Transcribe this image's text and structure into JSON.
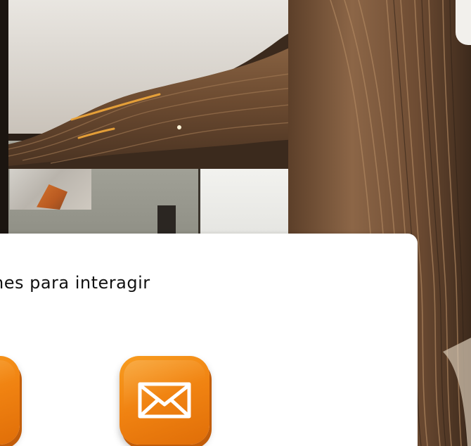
{
  "dialog": {
    "message": "nes para interagir",
    "buttons": [
      {
        "name": "contact-button",
        "icon": "phone-icon"
      },
      {
        "name": "email-button",
        "icon": "envelope-icon"
      }
    ]
  },
  "colors": {
    "accent": "#F08211",
    "accent_dark": "#C25D0A",
    "card_background": "#FFFFFF",
    "text": "#111111",
    "wood": "#7A5536"
  }
}
